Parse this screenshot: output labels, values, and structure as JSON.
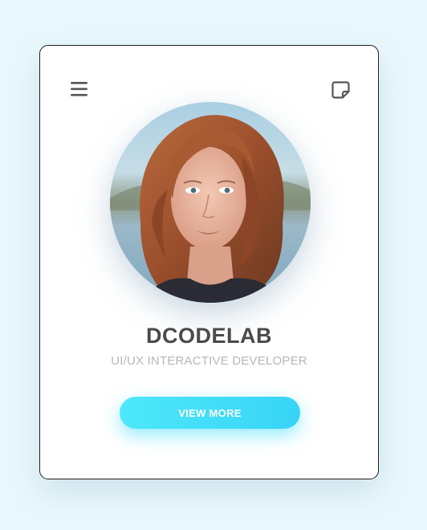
{
  "card": {
    "name": "DCODELAB",
    "role": "UI/UX INTERACTIVE DEVELOPER",
    "button_label": "VIEW MORE"
  },
  "icons": {
    "menu": "hamburger-menu-icon",
    "note": "sticky-note-icon"
  },
  "avatar": {
    "description_label": "profile-photo"
  },
  "colors": {
    "background": "#eaf8fd",
    "card": "#ffffff",
    "name_text": "#4a4a4a",
    "role_text": "#b7b7b7",
    "button_start": "#4ee8fb",
    "button_end": "#37d4f5",
    "icon": "#555555"
  }
}
